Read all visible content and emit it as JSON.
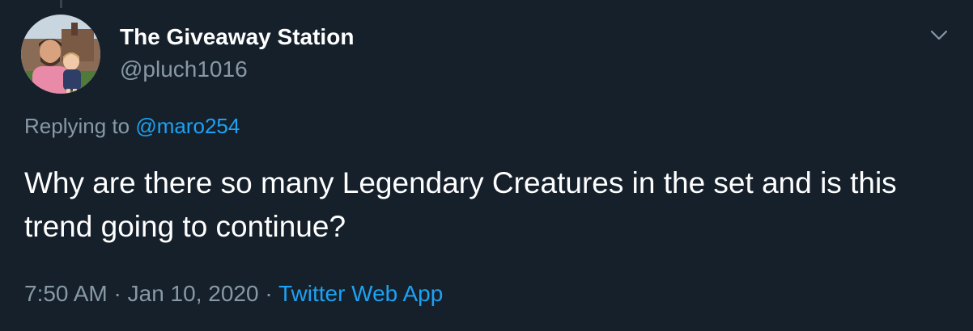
{
  "tweet": {
    "display_name": "The Giveaway Station",
    "handle": "@pluch1016",
    "replying_prefix": "Replying to",
    "replying_to": "@maro254",
    "text": "Why are there so many Legendary Creatures in the set and is this trend going to continue?",
    "time": "7:50 AM",
    "date": "Jan 10, 2020",
    "separator": "·",
    "source": "Twitter Web App"
  },
  "icons": {
    "menu": "chevron-down-icon",
    "avatar": "profile-photo"
  },
  "colors": {
    "background": "#15202b",
    "primary_text": "#ffffff",
    "secondary_text": "#8899a6",
    "link": "#1da1f2"
  }
}
